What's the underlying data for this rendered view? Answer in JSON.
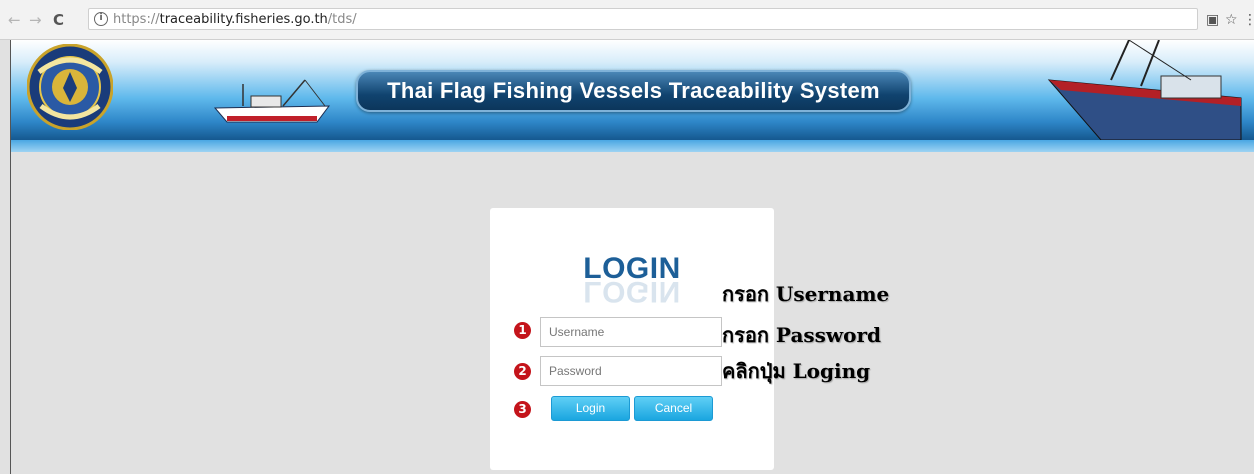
{
  "browser": {
    "back_icon": "back-arrow-icon",
    "back_glyph": "←",
    "forward_icon": "forward-arrow-icon",
    "forward_glyph": "→",
    "reload_icon": "reload-icon",
    "reload_glyph": "C",
    "info_icon": "info-icon",
    "info_glyph": "i",
    "url_scheme": "https://",
    "url_host": "traceability.fisheries.go.th",
    "url_path": "/tds/",
    "translate_icon": "translate-icon",
    "translate_glyph": "▣",
    "star_icon": "star-icon",
    "star_glyph": "☆",
    "menu_icon": "kebab-menu-icon",
    "menu_glyph": "⋮"
  },
  "banner": {
    "title": "Thai Flag Fishing Vessels Traceability System",
    "logo_text": "กรมประมง"
  },
  "login": {
    "title": "LOGIN",
    "username_placeholder": "Username",
    "password_placeholder": "Password",
    "login_button": "Login",
    "cancel_button": "Cancel"
  },
  "annotations": {
    "step1_number": "1",
    "step2_number": "2",
    "step3_number": "3",
    "step1_note": "กรอก Username",
    "step2_note": "กรอก Password",
    "step3_note": "คลิกปุ่ม Loging"
  },
  "colors": {
    "accent_blue": "#1d5f98",
    "button_blue": "#1aa6e0",
    "step_red": "#c4141b",
    "page_bg": "#e1e1e1"
  }
}
